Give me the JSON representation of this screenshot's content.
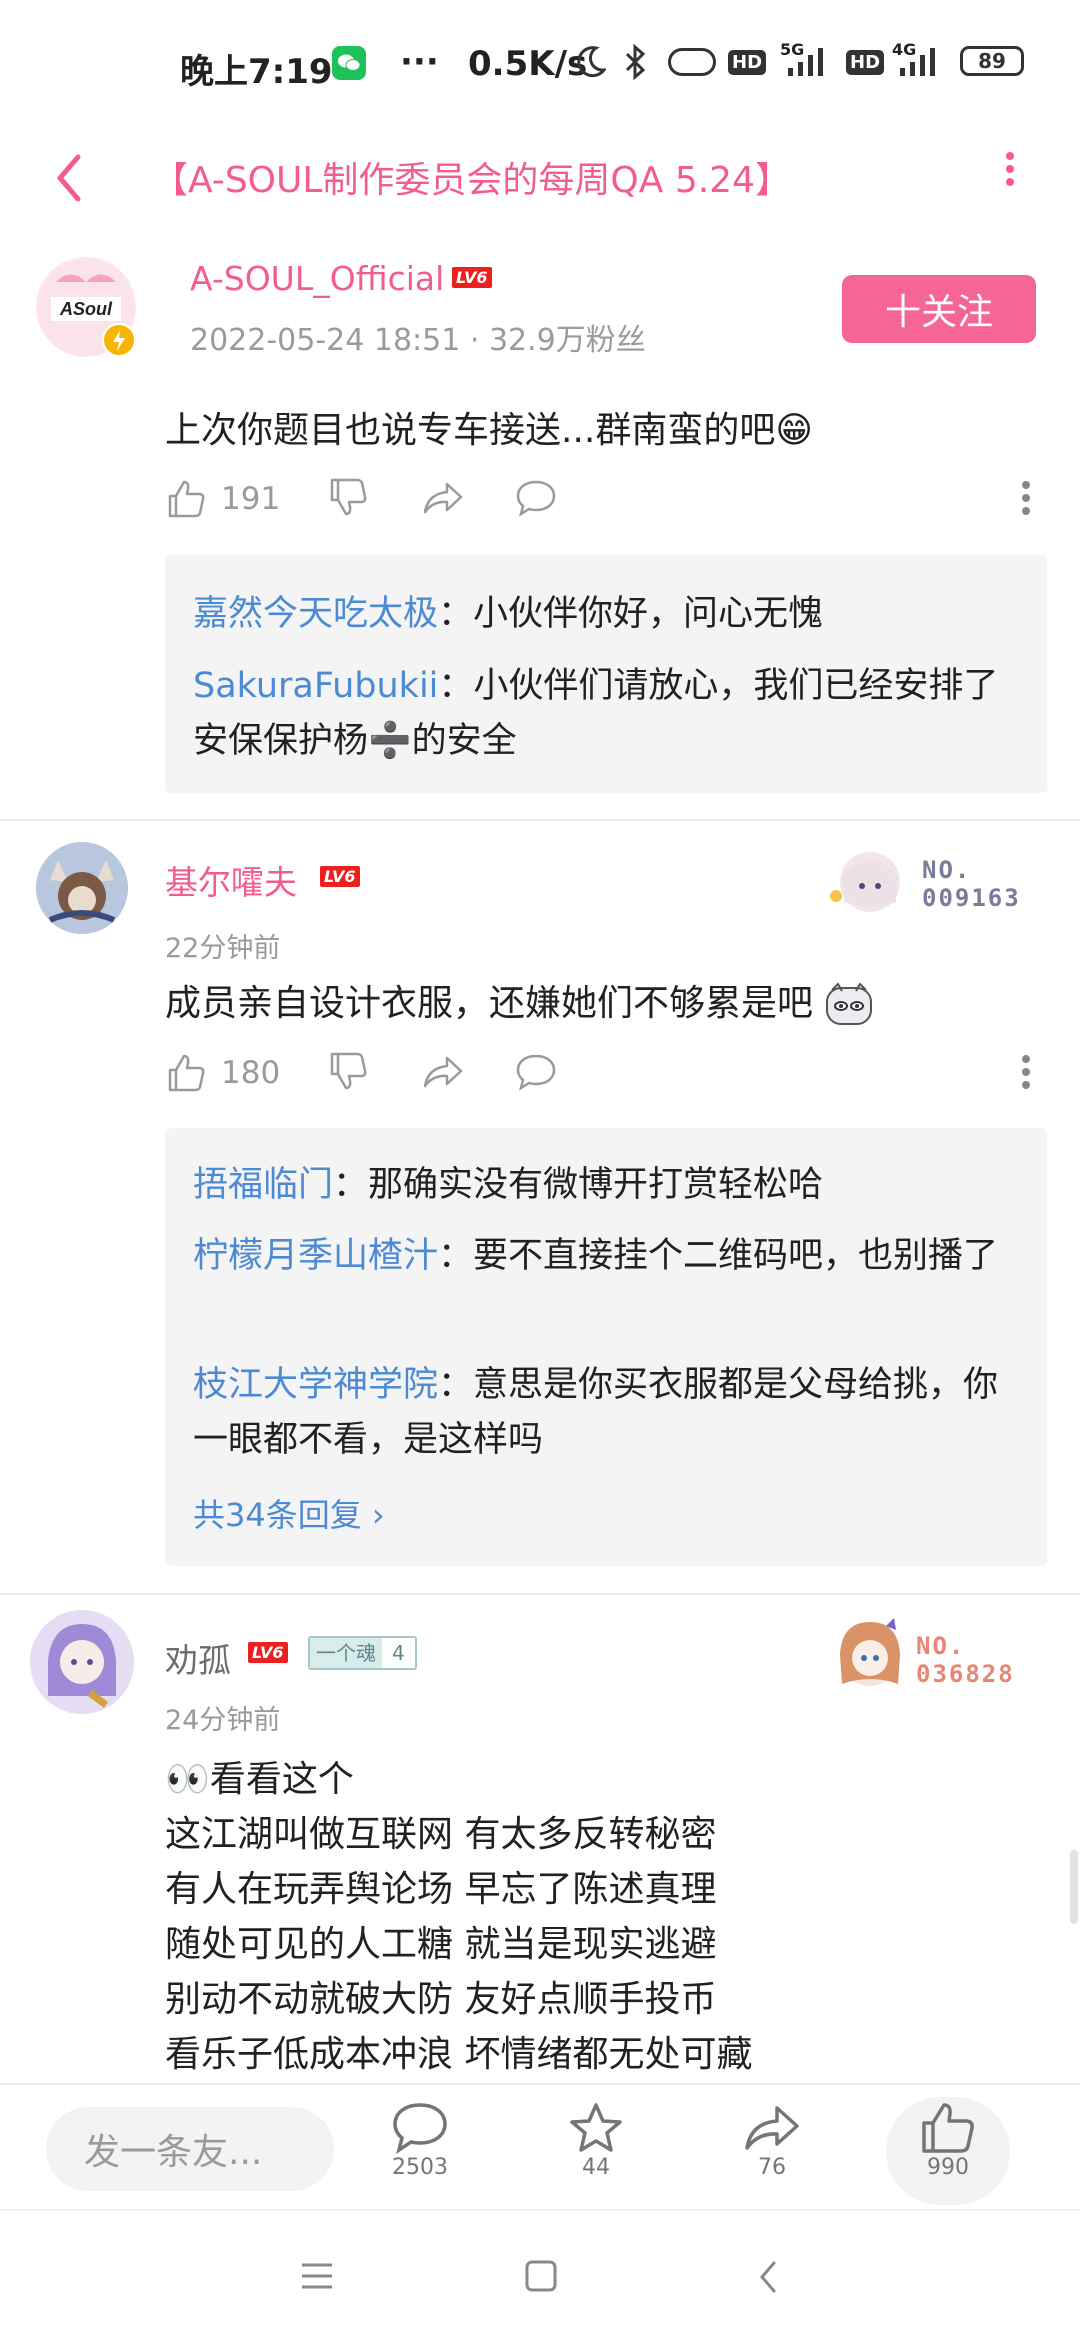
{
  "status_bar": {
    "time": "晚上7:19",
    "more": "···",
    "speed": "0.5K/s",
    "net1": "5G",
    "net2": "4G",
    "hd1": "HD",
    "hd2": "HD",
    "battery": "89"
  },
  "header": {
    "title": "【A-SOUL制作委员会的每周QA 5.24】",
    "accent": "#f25d8e"
  },
  "post": {
    "author": "A-SOUL_Official",
    "level": "LV6",
    "meta": "2022-05-24 18:51 · 32.9万粉丝",
    "follow_label": "十关注",
    "avatar_text": "ASoul"
  },
  "comments": [
    {
      "text": "上次你题目也说专车接送...群南蛮的吧😁",
      "likes": "191",
      "replies": [
        {
          "name": "嘉然今天吃太极",
          "sep": "：",
          "text": "小伙伴你好，问心无愧"
        },
        {
          "name": "SakuraFubukii",
          "sep": "：",
          "text": "小伙伴们请放心，我们已经安排了安保保护杨➗的安全"
        }
      ]
    },
    {
      "user": "基尔嚯夫",
      "level": "LV6",
      "time": "22分钟前",
      "badge_no": "NO.",
      "badge_num": "009163",
      "text": "成员亲自设计衣服，还嫌她们不够累是吧",
      "likes": "180",
      "replies": [
        {
          "name": "捂福临门",
          "sep": "：",
          "text": "那确实没有微博开打赏轻松哈"
        },
        {
          "name": "柠檬月季山楂汁",
          "sep": "：",
          "text": "要不直接挂个二维码吧，也别播了"
        },
        {
          "name": "枝江大学神学院",
          "sep": "：",
          "text": "意思是你买衣服都是父母给挑，你一眼都不看，是这样吗"
        }
      ],
      "more_replies": "共34条回复 ›"
    },
    {
      "user": "劝孤",
      "level": "LV6",
      "medal_name": "一个魂",
      "medal_level": "4",
      "time": "24分钟前",
      "badge_no": "NO.",
      "badge_num": "036828",
      "lines": [
        "👀看看这个",
        "这江湖叫做互联网 有太多反转秘密",
        "有人在玩弄舆论场 早忘了陈述真理",
        "随处可见的人工糖 就当是现实逃避",
        "别动不动就破大防 友好点顺手投币",
        "看乐子低成本冲浪 坏情绪都无处可藏"
      ]
    }
  ],
  "bottom_bar": {
    "input_placeholder": "发一条友...",
    "comments_count": "2503",
    "favorites_count": "44",
    "shares_count": "76",
    "likes_count": "990"
  }
}
